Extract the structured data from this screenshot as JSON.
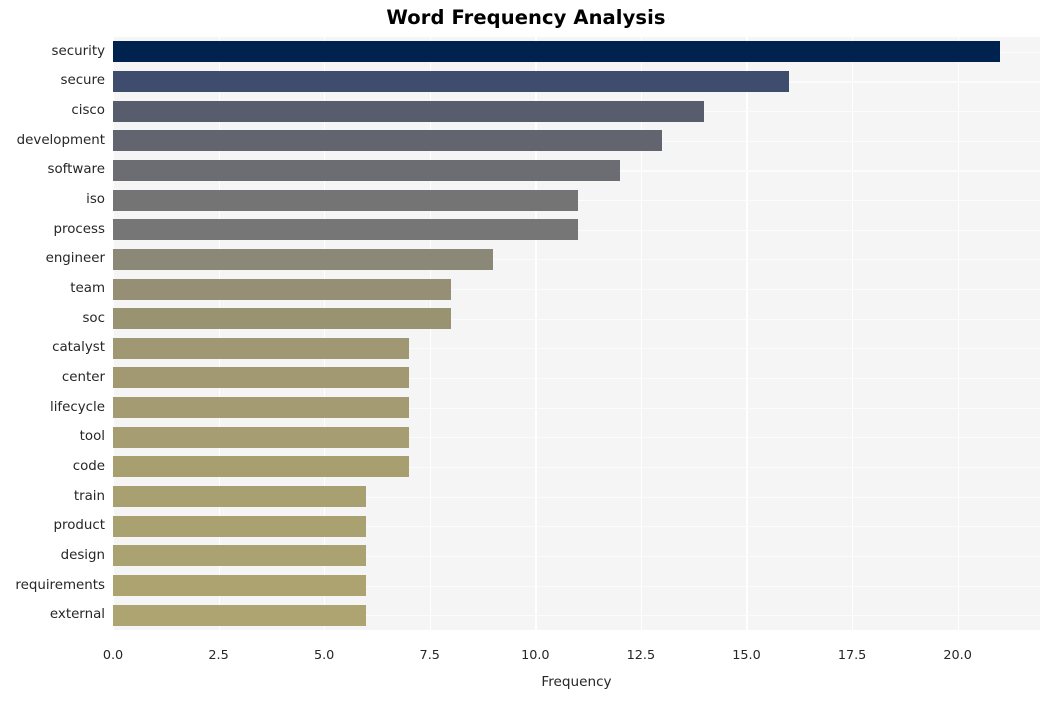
{
  "chart_data": {
    "type": "bar",
    "orientation": "horizontal",
    "title": "Word Frequency Analysis",
    "xlabel": "Frequency",
    "ylabel": "",
    "categories": [
      "security",
      "secure",
      "cisco",
      "development",
      "software",
      "iso",
      "process",
      "engineer",
      "team",
      "soc",
      "catalyst",
      "center",
      "lifecycle",
      "tool",
      "code",
      "train",
      "product",
      "design",
      "requirements",
      "external"
    ],
    "values": [
      21,
      16,
      14,
      13,
      12,
      11,
      11,
      9,
      8,
      8,
      7,
      7,
      7,
      7,
      7,
      6,
      6,
      6,
      6,
      6
    ],
    "xlim": [
      0,
      21.95
    ],
    "xticks": [
      0.0,
      2.5,
      5.0,
      7.5,
      10.0,
      12.5,
      15.0,
      17.5,
      20.0
    ],
    "xtick_labels": [
      "0.0",
      "2.5",
      "5.0",
      "7.5",
      "10.0",
      "12.5",
      "15.0",
      "17.5",
      "20.0"
    ],
    "grid": true,
    "legend": "none",
    "colormap": "cividis",
    "bar_colors": [
      "#00224e",
      "#3e4c6d",
      "#575d6d",
      "#626570",
      "#6b6d72",
      "#747474",
      "#767676",
      "#8b8878",
      "#968f75",
      "#9a9372",
      "#a09773",
      "#a29972",
      "#a49b72",
      "#a69d72",
      "#a89f71",
      "#a9a071",
      "#aaa171",
      "#aba271",
      "#aca371",
      "#ada471"
    ],
    "plot_background": "#f5f5f6",
    "gridline_color": "#ffffff",
    "text_color": "#262626"
  }
}
